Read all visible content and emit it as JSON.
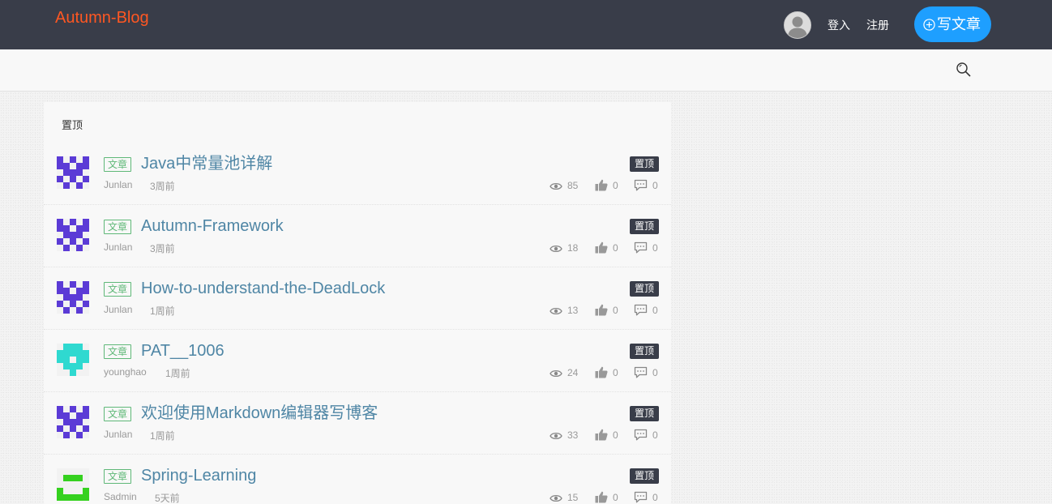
{
  "header": {
    "brand": "Autumn-Blog",
    "login": "登入",
    "register": "注册",
    "write_button": "写文章"
  },
  "panel": {
    "title": "置顶"
  },
  "posts": [
    {
      "type": "文章",
      "title": "Java中常量池详解",
      "author": "Junlan",
      "time": "3周前",
      "pin": "置顶",
      "views": "85",
      "likes": "0",
      "comments": "0",
      "avatar": "purple"
    },
    {
      "type": "文章",
      "title": "Autumn-Framework",
      "author": "Junlan",
      "time": "3周前",
      "pin": "置顶",
      "views": "18",
      "likes": "0",
      "comments": "0",
      "avatar": "purple"
    },
    {
      "type": "文章",
      "title": "How-to-understand-the-DeadLock",
      "author": "Junlan",
      "time": "1周前",
      "pin": "置顶",
      "views": "13",
      "likes": "0",
      "comments": "0",
      "avatar": "purple"
    },
    {
      "type": "文章",
      "title": "PAT__1006",
      "author": "younghao",
      "time": "1周前",
      "pin": "置顶",
      "views": "24",
      "likes": "0",
      "comments": "0",
      "avatar": "cyan"
    },
    {
      "type": "文章",
      "title": "欢迎使用Markdown编辑器写博客",
      "author": "Junlan",
      "time": "1周前",
      "pin": "置顶",
      "views": "33",
      "likes": "0",
      "comments": "0",
      "avatar": "purple"
    },
    {
      "type": "文章",
      "title": "Spring-Learning",
      "author": "Sadmin",
      "time": "5天前",
      "pin": "置顶",
      "views": "15",
      "likes": "0",
      "comments": "0",
      "avatar": "green"
    }
  ],
  "colors": {
    "topbar": "#393d49",
    "brand": "#ff5722",
    "accent": "#1e9fff",
    "badge_green": "#5fb878",
    "title_link": "#4f86a5",
    "avatar_purple": "#5b3bd6",
    "avatar_cyan": "#2fd9d0",
    "avatar_green": "#35d11f"
  },
  "icons": {
    "user": "user-avatar-icon",
    "plus": "plus-circle-icon",
    "search": "search-icon",
    "views": "eye-icon",
    "likes": "thumbs-up-icon",
    "comments": "comment-icon"
  }
}
